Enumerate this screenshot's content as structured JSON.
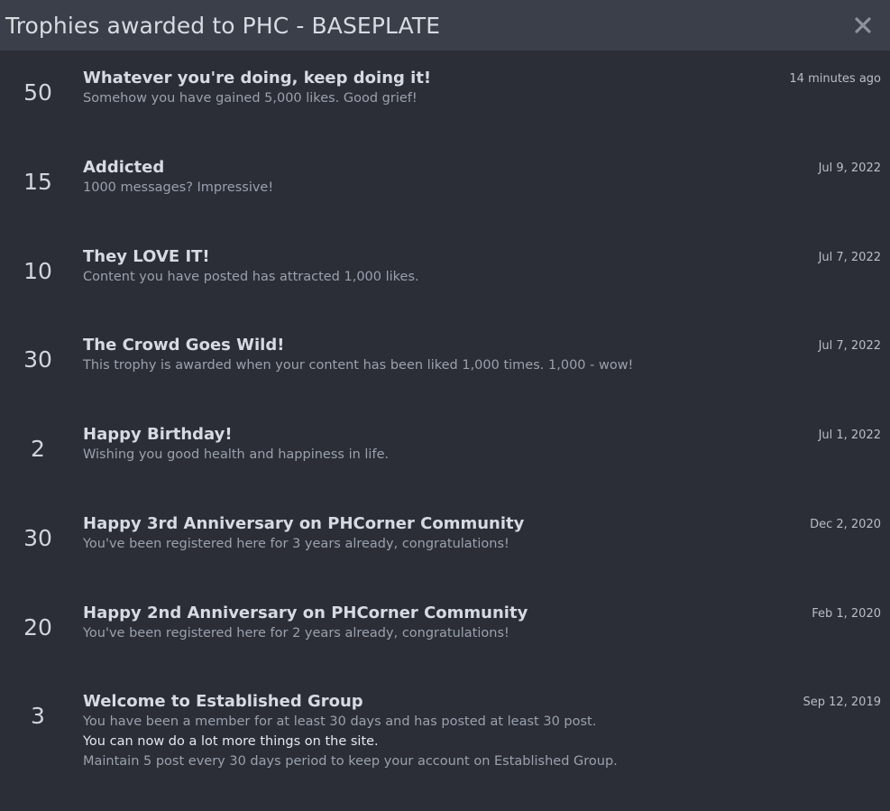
{
  "header": {
    "title": "Trophies awarded to PHC - BASEPLATE",
    "close_icon": "close-icon"
  },
  "trophies": [
    {
      "points": "50",
      "title": "Whatever you're doing, keep doing it!",
      "description": [
        "Somehow you have gained 5,000 likes. Good grief!"
      ],
      "date": "14 minutes ago"
    },
    {
      "points": "15",
      "title": "Addicted",
      "description": [
        "1000 messages? Impressive!"
      ],
      "date": "Jul 9, 2022"
    },
    {
      "points": "10",
      "title": "They LOVE IT!",
      "description": [
        "Content you have posted has attracted 1,000 likes."
      ],
      "date": "Jul 7, 2022"
    },
    {
      "points": "30",
      "title": "The Crowd Goes Wild!",
      "description": [
        "This trophy is awarded when your content has been liked 1,000 times. 1,000 - wow!"
      ],
      "date": "Jul 7, 2022"
    },
    {
      "points": "2",
      "title": "Happy Birthday!",
      "description": [
        "Wishing you good health and happiness in life."
      ],
      "date": "Jul 1, 2022"
    },
    {
      "points": "30",
      "title": "Happy 3rd Anniversary on PHCorner Community",
      "description": [
        "You've been registered here for 3 years already, congratulations!"
      ],
      "date": "Dec 2, 2020"
    },
    {
      "points": "20",
      "title": "Happy 2nd Anniversary on PHCorner Community",
      "description": [
        "You've been registered here for 2 years already, congratulations!"
      ],
      "date": "Feb 1, 2020"
    },
    {
      "points": "3",
      "title": "Welcome to Established Group",
      "description": [
        "You have been a member for at least 30 days and has posted at least 30 post.",
        "You can now do a lot more things on the site.",
        "Maintain 5 post every 30 days period to keep your account on Established Group."
      ],
      "date": "Sep 12, 2019"
    }
  ]
}
